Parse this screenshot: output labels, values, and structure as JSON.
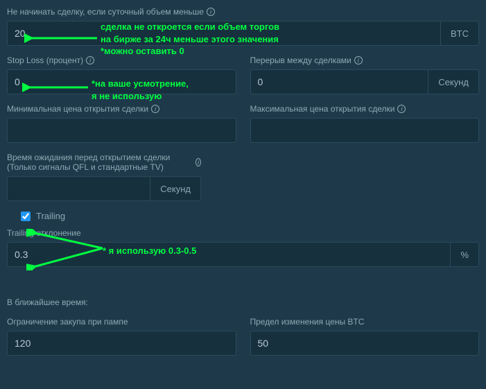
{
  "fields": {
    "volume": {
      "label": "Не начинать сделку, если суточный объем меньше",
      "value": "20",
      "unit": "BTC"
    },
    "stoploss": {
      "label": "Stop Loss (процент)",
      "value": "0"
    },
    "pause": {
      "label": "Перерыв между сделками",
      "value": "0",
      "unit": "Секунд"
    },
    "minprice": {
      "label": "Минимальная цена открытия сделки",
      "value": ""
    },
    "maxprice": {
      "label": "Максимальная цена открытия сделки",
      "value": ""
    },
    "delay": {
      "label": "Время ожидания перед открытием сделки (Только сигналы QFL и стандартные TV)",
      "value": "",
      "unit": "Секунд"
    },
    "trailing_toggle": {
      "label": "Trailing"
    },
    "trailing_dev": {
      "label": "Trailing отклонение",
      "value": "0.3",
      "unit": "%"
    },
    "soon_header": "В ближайшее время:",
    "pump_limit": {
      "label": "Ограничение закупа при пампе",
      "value": "120"
    },
    "btc_limit": {
      "label": "Предел изменения цены BTC",
      "value": "50"
    }
  },
  "annotations": {
    "a1": "сделка не откроется если объем торгов\nна бирже за 24ч меньше этого значения\n*можно оставить 0",
    "a2": "*на ваше усмотрение,\nя не использую",
    "a3": "* я использую 0.3-0.5"
  }
}
